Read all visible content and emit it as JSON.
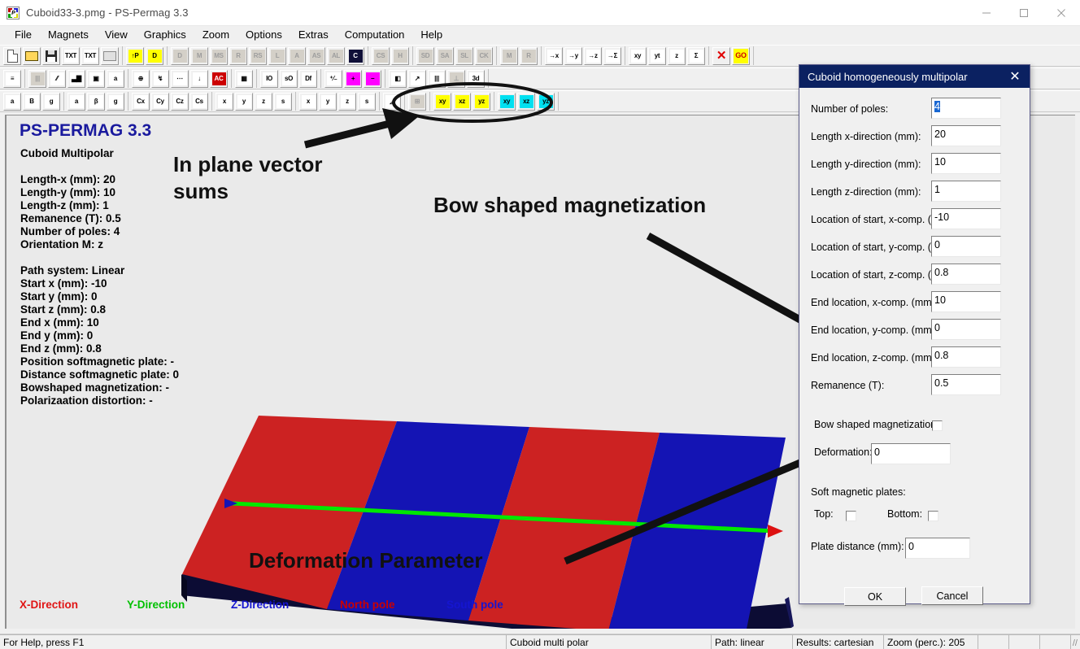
{
  "window": {
    "title": "Cuboid33-3.pmg - PS-Permag 3.3",
    "icon": "app-icon",
    "minimize": "minimize-icon",
    "maximize": "maximize-icon",
    "close": "close-icon"
  },
  "menu": {
    "items": [
      "File",
      "Magnets",
      "View",
      "Graphics",
      "Zoom",
      "Options",
      "Extras",
      "Computation",
      "Help"
    ]
  },
  "toolbars": {
    "row1": [
      {
        "g": "doc",
        "label": "",
        "icon": "new-document-icon",
        "style": "doc"
      },
      {
        "g": "doc",
        "label": "",
        "icon": "open-folder-icon",
        "style": "folder"
      },
      {
        "g": "doc",
        "label": "",
        "icon": "save-disk-icon",
        "style": "disk"
      },
      {
        "g": "doc",
        "label": "TXT",
        "icon": "import-text-icon",
        "style": "w"
      },
      {
        "g": "doc",
        "label": "TXT",
        "icon": "export-text-icon",
        "style": "w"
      },
      {
        "g": "doc",
        "label": "",
        "icon": "print-icon",
        "style": "print",
        "disabled": true
      },
      {
        "g": "pd",
        "label": "↑P",
        "icon": "parameter-up-icon",
        "style": "y"
      },
      {
        "g": "pd",
        "label": "D",
        "icon": "data-list-icon",
        "style": "y"
      },
      {
        "g": "m3d",
        "label": "D",
        "icon": "magnet-3d-d-icon",
        "style": "gray",
        "disabled": true
      },
      {
        "g": "m3d",
        "label": "M",
        "icon": "magnet-3d-m-icon",
        "style": "gray",
        "disabled": true
      },
      {
        "g": "m3d",
        "label": "MS",
        "icon": "magnet-3d-ms-icon",
        "style": "gray",
        "disabled": true
      },
      {
        "g": "m3d",
        "label": "R",
        "icon": "magnet-3d-r-icon",
        "style": "gray",
        "disabled": true
      },
      {
        "g": "m3d",
        "label": "RS",
        "icon": "magnet-3d-rs-icon",
        "style": "gray",
        "disabled": true
      },
      {
        "g": "m3d",
        "label": "L",
        "icon": "magnet-3d-l-icon",
        "style": "gray",
        "disabled": true
      },
      {
        "g": "m3d",
        "label": "A",
        "icon": "magnet-3d-a-icon",
        "style": "gray",
        "disabled": true
      },
      {
        "g": "m3d",
        "label": "AS",
        "icon": "magnet-3d-as-icon",
        "style": "gray",
        "disabled": true
      },
      {
        "g": "m3d",
        "label": "AL",
        "icon": "magnet-3d-al-icon",
        "style": "gray",
        "disabled": true
      },
      {
        "g": "m3d",
        "label": "C",
        "icon": "magnet-3d-c-icon",
        "style": "k"
      },
      {
        "g": "m3d2",
        "label": "CS",
        "icon": "magnet-3d-cs-icon",
        "style": "gray",
        "disabled": true
      },
      {
        "g": "m3d2",
        "label": "H",
        "icon": "magnet-3d-h-icon",
        "style": "gray",
        "disabled": true
      },
      {
        "g": "m3d3",
        "label": "SD",
        "icon": "magnet-3d-sd-icon",
        "style": "gray",
        "disabled": true
      },
      {
        "g": "m3d3",
        "label": "SA",
        "icon": "magnet-3d-sa-icon",
        "style": "gray",
        "disabled": true
      },
      {
        "g": "m3d3",
        "label": "SL",
        "icon": "magnet-3d-sl-icon",
        "style": "gray",
        "disabled": true
      },
      {
        "g": "m3d3",
        "label": "CK",
        "icon": "magnet-3d-ck-icon",
        "style": "gray",
        "disabled": true
      },
      {
        "g": "m2d",
        "label": "M",
        "icon": "magnet-2d-m-icon",
        "style": "gray",
        "disabled": true
      },
      {
        "g": "m2d",
        "label": "R",
        "icon": "magnet-2d-r-icon",
        "style": "gray",
        "disabled": true
      },
      {
        "g": "pth",
        "label": "→x",
        "icon": "path-x-icon",
        "style": "w"
      },
      {
        "g": "pth",
        "label": "→y",
        "icon": "path-y-icon",
        "style": "w"
      },
      {
        "g": "pth",
        "label": "→z",
        "icon": "path-z-icon",
        "style": "w"
      },
      {
        "g": "pth",
        "label": "→Σ",
        "icon": "path-sum-icon",
        "style": "w"
      },
      {
        "g": "pth2",
        "label": "xy",
        "icon": "path-plane-xy-icon",
        "style": "w"
      },
      {
        "g": "pth2",
        "label": "yt",
        "icon": "path-plane-yt-icon",
        "style": "w"
      },
      {
        "g": "pth2",
        "label": "z",
        "icon": "path-plane-z-icon",
        "style": "w"
      },
      {
        "g": "pth2",
        "label": "Σ",
        "icon": "path-plane-sum-icon",
        "style": "w"
      },
      {
        "g": "run",
        "label": "✕",
        "icon": "cancel-run-icon",
        "style": "redX"
      },
      {
        "g": "run",
        "label": "GO",
        "icon": "go-button-icon",
        "style": "goT"
      }
    ],
    "row2": [
      {
        "g": "a",
        "label": "≡",
        "icon": "color-legend-icon",
        "style": "w"
      },
      {
        "g": "b",
        "label": "|||",
        "icon": "grid-columns-icon",
        "style": "gray",
        "disabled": true
      },
      {
        "g": "b",
        "label": "⁄⁄",
        "icon": "curve-icon",
        "style": "w"
      },
      {
        "g": "b",
        "label": "▃▇",
        "icon": "bar-chart-icon",
        "style": "w"
      },
      {
        "g": "b",
        "label": "▣",
        "icon": "color-palette-icon",
        "style": "w"
      },
      {
        "g": "b",
        "label": "a",
        "icon": "text-color-icon",
        "style": "w"
      },
      {
        "g": "c",
        "label": "⊕",
        "icon": "crosshair-icon",
        "style": "w"
      },
      {
        "g": "c",
        "label": "↯",
        "icon": "vector-arrows-icon",
        "style": "w"
      },
      {
        "g": "c",
        "label": "⋯",
        "icon": "dotted-line-icon",
        "style": "w"
      },
      {
        "g": "c",
        "label": "↓",
        "icon": "drop-down-icon",
        "style": "w"
      },
      {
        "g": "c",
        "label": "AC",
        "icon": "ac-icon",
        "style": "rd"
      },
      {
        "g": "d",
        "label": "▦",
        "icon": "table-icon",
        "style": "w"
      },
      {
        "g": "e",
        "label": "IO",
        "icon": "io-icon",
        "style": "w"
      },
      {
        "g": "e",
        "label": "sO",
        "icon": "so-icon",
        "style": "w"
      },
      {
        "g": "e",
        "label": "Df",
        "icon": "df-icon",
        "style": "w"
      },
      {
        "g": "f",
        "label": "⁺⁄₋",
        "icon": "plus-minus-icon",
        "style": "w"
      },
      {
        "g": "f",
        "label": "+",
        "icon": "add-icon",
        "style": "mg"
      },
      {
        "g": "f",
        "label": "−",
        "icon": "subtract-icon",
        "style": "mg"
      },
      {
        "g": "g",
        "label": "◧",
        "icon": "diagonal-fill-icon",
        "style": "w"
      },
      {
        "g": "g",
        "label": "↗",
        "icon": "axes-icon",
        "style": "w"
      },
      {
        "g": "g",
        "label": "|||",
        "icon": "stripes-icon",
        "style": "w"
      },
      {
        "g": "g",
        "label": "⊥",
        "icon": "perpendicular-icon",
        "style": "gray",
        "disabled": true
      },
      {
        "g": "g",
        "label": "3d",
        "icon": "three-d-plot-icon",
        "style": "w"
      }
    ],
    "row3": [
      {
        "g": "a",
        "label": "a",
        "icon": "label-a-icon",
        "style": "w"
      },
      {
        "g": "a",
        "label": "B",
        "icon": "label-b-icon",
        "style": "w"
      },
      {
        "g": "a",
        "label": "g",
        "icon": "label-g-icon",
        "style": "w"
      },
      {
        "g": "b",
        "label": "a",
        "icon": "curve-a-icon",
        "style": "w"
      },
      {
        "g": "b",
        "label": "β",
        "icon": "curve-beta-icon",
        "style": "w"
      },
      {
        "g": "b",
        "label": "g",
        "icon": "curve-g-icon",
        "style": "w"
      },
      {
        "g": "c",
        "label": "Cx",
        "icon": "comp-cx-icon",
        "style": "w"
      },
      {
        "g": "c",
        "label": "Cy",
        "icon": "comp-cy-icon",
        "style": "w"
      },
      {
        "g": "c",
        "label": "Cz",
        "icon": "comp-cz-icon",
        "style": "w"
      },
      {
        "g": "c",
        "label": "Cs",
        "icon": "comp-cs-icon",
        "style": "w"
      },
      {
        "g": "d",
        "label": "x",
        "icon": "bar-x-icon",
        "style": "w"
      },
      {
        "g": "d",
        "label": "y",
        "icon": "bar-y-icon",
        "style": "w"
      },
      {
        "g": "d",
        "label": "z",
        "icon": "bar-z-icon",
        "style": "w"
      },
      {
        "g": "d",
        "label": "s",
        "icon": "bar-s-icon",
        "style": "w"
      },
      {
        "g": "e",
        "label": "x",
        "icon": "plot-x-icon",
        "style": "w"
      },
      {
        "g": "e",
        "label": "y",
        "icon": "plot-y-icon",
        "style": "w"
      },
      {
        "g": "e",
        "label": "z",
        "icon": "plot-z-icon",
        "style": "w"
      },
      {
        "g": "e",
        "label": "s",
        "icon": "plot-s-icon",
        "style": "w"
      },
      {
        "g": "f",
        "label": "◿",
        "icon": "plot-area-icon",
        "style": "w"
      },
      {
        "g": "g",
        "label": "⊞",
        "icon": "plot-empty-icon",
        "style": "gray",
        "disabled": true
      },
      {
        "g": "h",
        "label": "xy",
        "icon": "vector-sum-xy-icon",
        "style": "y"
      },
      {
        "g": "h",
        "label": "xz",
        "icon": "vector-sum-xz-icon",
        "style": "y"
      },
      {
        "g": "h",
        "label": "yz",
        "icon": "vector-sum-yz-icon",
        "style": "y"
      },
      {
        "g": "i",
        "label": "xy",
        "icon": "angle-xy-icon",
        "style": "c"
      },
      {
        "g": "i",
        "label": "xz",
        "icon": "angle-xz-icon",
        "style": "c"
      },
      {
        "g": "i",
        "label": "yz",
        "icon": "angle-yz-icon",
        "style": "c"
      }
    ]
  },
  "canvas": {
    "app_title": "PS-PERMAG 3.3",
    "subtitle": "Cuboid Multipolar",
    "info_lines": [
      "Length-x (mm): 20",
      "Length-y (mm): 10",
      "Length-z (mm): 1",
      "Remanence (T): 0.5",
      "Number of poles: 4",
      "Orientation M: z"
    ],
    "path_lines": [
      "Path system: Linear",
      "Start x (mm): -10",
      "Start y (mm): 0",
      "Start z (mm): 0.8",
      "End x (mm): 10",
      "End y (mm): 0",
      "End z (mm): 0.8",
      "Position softmagnetic plate: -",
      "Distance softmagnetic plate: 0",
      "Bowshaped magnetization: -",
      "Polarizaation distortion: -"
    ],
    "legend": [
      {
        "label": "X-Direction",
        "color": "#e01515"
      },
      {
        "label": "Y-Direction",
        "color": "#00c000"
      },
      {
        "label": "Z-Direction",
        "color": "#1515d0"
      },
      {
        "label": "North pole",
        "color": "#cc0000"
      },
      {
        "label": "South pole",
        "color": "#1515d0"
      }
    ],
    "plate": {
      "pole_colors": [
        "#cc2222",
        "#1414b4",
        "#cc2222",
        "#1414b4"
      ],
      "side_color": "#0c0c34",
      "path_color": "#00e800",
      "start_marker_color": "#1414b4",
      "end_marker_color": "#dd1111",
      "pole_count": 4
    }
  },
  "annotations": [
    {
      "id": "in-plane",
      "text": "In plane vector\nsums"
    },
    {
      "id": "bow",
      "text": "Bow shaped magnetization"
    },
    {
      "id": "deformation",
      "text": "Deformation Parameter"
    }
  ],
  "annotation_texts": {
    "in_plane_l1": "In plane vector",
    "in_plane_l2": "sums",
    "bow": "Bow shaped magnetization",
    "deformation": "Deformation Parameter"
  },
  "dialog": {
    "title": "Cuboid homogeneously multipolar",
    "close": "close-icon",
    "fields": [
      {
        "label": "Number of poles:",
        "value": "4",
        "selected": true
      },
      {
        "label": "Length x-direction (mm):",
        "value": "20"
      },
      {
        "label": "Length y-direction (mm):",
        "value": "10"
      },
      {
        "label": "Length z-direction (mm):",
        "value": "1"
      },
      {
        "label": "Location of start, x-comp. (mm):",
        "value": "-10"
      },
      {
        "label": "Location of start, y-comp. (mm):",
        "value": "0"
      },
      {
        "label": "Location of start, z-comp. (mm):",
        "value": "0.8"
      },
      {
        "label": "End location, x-comp. (mm):",
        "value": "10"
      },
      {
        "label": "End location, y-comp. (mm):",
        "value": "0"
      },
      {
        "label": "End location, z-comp. (mm):",
        "value": "0.8"
      },
      {
        "label": "Remanence (T):",
        "value": "0.5"
      }
    ],
    "bow_label": "Bow shaped magnetization:",
    "bow_checked": false,
    "deformation_label": "Deformation:",
    "deformation_value": "0",
    "soft_plates_label": "Soft magnetic plates:",
    "top_label": "Top:",
    "top_checked": false,
    "bottom_label": "Bottom:",
    "bottom_checked": false,
    "plate_distance_label": "Plate distance (mm):",
    "plate_distance_value": "0",
    "ok_label": "OK",
    "cancel_label": "Cancel"
  },
  "statusbar": {
    "help": "For Help, press F1",
    "cells": [
      "Cuboid multi polar",
      "Path: linear",
      "Results: cartesian",
      "Zoom (perc.): 205",
      "",
      "",
      ""
    ]
  }
}
